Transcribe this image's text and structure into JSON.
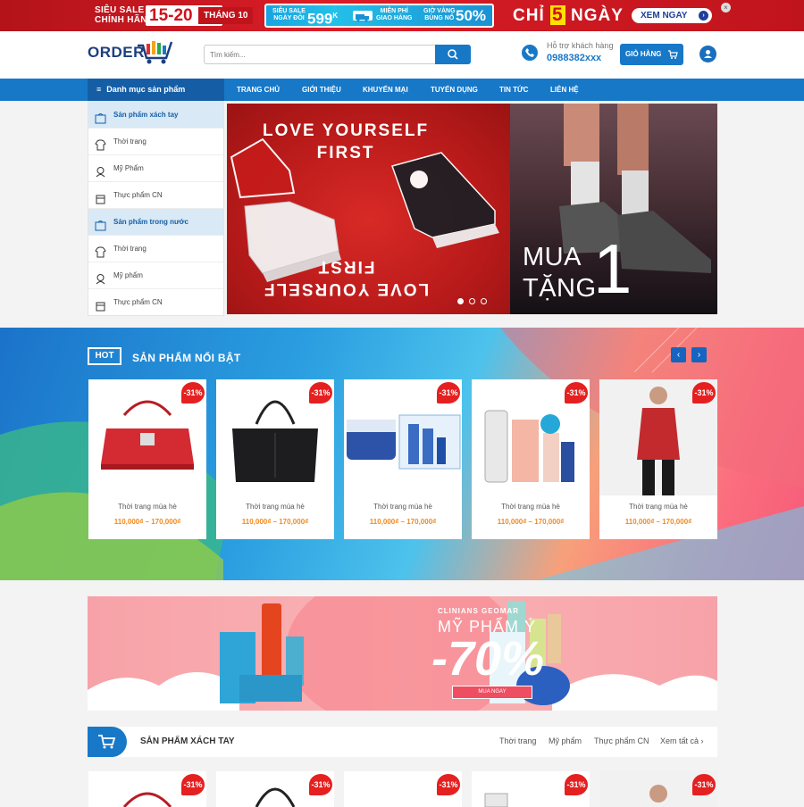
{
  "promo": {
    "sieu_sale": "SIÊU SALE",
    "chinh_hang": "CHÍNH HÃNG",
    "dates": "15-20",
    "month": "THÁNG 10",
    "strip": {
      "s1a": "SIÊU SALE",
      "s1b": "NGÀY ĐÔI",
      "price": "599",
      "price_sup": "K",
      "s2a": "MIỄN PHÍ",
      "s2b": "GIAO HÀNG",
      "s3a": "GIỜ VÀNG",
      "s3b": "BÙNG NỔ",
      "percent": "50%"
    },
    "chi": "CHỈ",
    "five": "5",
    "ngay": "NGÀY",
    "cta": "XEM NGAY"
  },
  "header": {
    "logo": "ORDER",
    "search_placeholder": "Tìm kiếm...",
    "support_label": "Hỗ trợ khách hàng",
    "hotline": "0988382xxx",
    "cart_label": "GIỎ HÀNG"
  },
  "nav": {
    "category_head": "Danh mục sản phẩm",
    "items": [
      "TRANG CHỦ",
      "GIỚI THIỆU",
      "KHUYẾN MẠI",
      "TUYỂN DỤNG",
      "TIN TỨC",
      "LIÊN HỆ"
    ]
  },
  "sidebar": {
    "items": [
      {
        "label": "Sản phẩm xách tay",
        "icon": "bag-icon"
      },
      {
        "label": "Thời trang",
        "icon": "shirt-icon"
      },
      {
        "label": "Mỹ Phẩm",
        "icon": "cosmetic-icon"
      },
      {
        "label": "Thực phẩm CN",
        "icon": "food-icon"
      },
      {
        "label": "Sản phẩm trong nước",
        "icon": "bag-icon"
      },
      {
        "label": "Thời trang",
        "icon": "shirt-icon"
      },
      {
        "label": "Mỹ phẩm",
        "icon": "cosmetic-icon"
      },
      {
        "label": "Thực phẩm CN",
        "icon": "food-icon"
      }
    ]
  },
  "hero": {
    "love_line1": "LOVE YOURSELF",
    "love_line2": "FIRST",
    "mua": "MUA",
    "tang": "TẶNG",
    "one": "1"
  },
  "featured": {
    "badge": "HOT",
    "title": "SẢN PHẨM NỔI BẬT",
    "products": [
      {
        "name": "Thời trang mùa hè",
        "price": "110,000₫ – 170,000₫",
        "discount": "-31%"
      },
      {
        "name": "Thời trang mùa hè",
        "price": "110,000₫ – 170,000₫",
        "discount": "-31%"
      },
      {
        "name": "Thời trang mùa hè",
        "price": "110,000₫ – 170,000₫",
        "discount": "-31%"
      },
      {
        "name": "Thời trang mùa hè",
        "price": "110,000₫ – 170,000₫",
        "discount": "-31%"
      },
      {
        "name": "Thời trang mùa hè",
        "price": "110,000₫ – 170,000₫",
        "discount": "-31%"
      }
    ]
  },
  "cosmetic_banner": {
    "brand": "CLINIANS  GEOMAR",
    "title": "MỸ PHẨM Ý",
    "discount": "-70%",
    "cta": "MUA NGAY"
  },
  "section2": {
    "title": "SẢN PHẨM XÁCH TAY",
    "links": [
      "Thời trang",
      "Mỹ phẩm",
      "Thực phẩm CN",
      "Xem tất cả"
    ],
    "discounts": [
      "-31%",
      "-31%",
      "-31%",
      "-31%",
      "-31%"
    ]
  },
  "colors": {
    "primary": "#1878c8",
    "promo_red": "#d0121b",
    "price": "#f28a20"
  }
}
